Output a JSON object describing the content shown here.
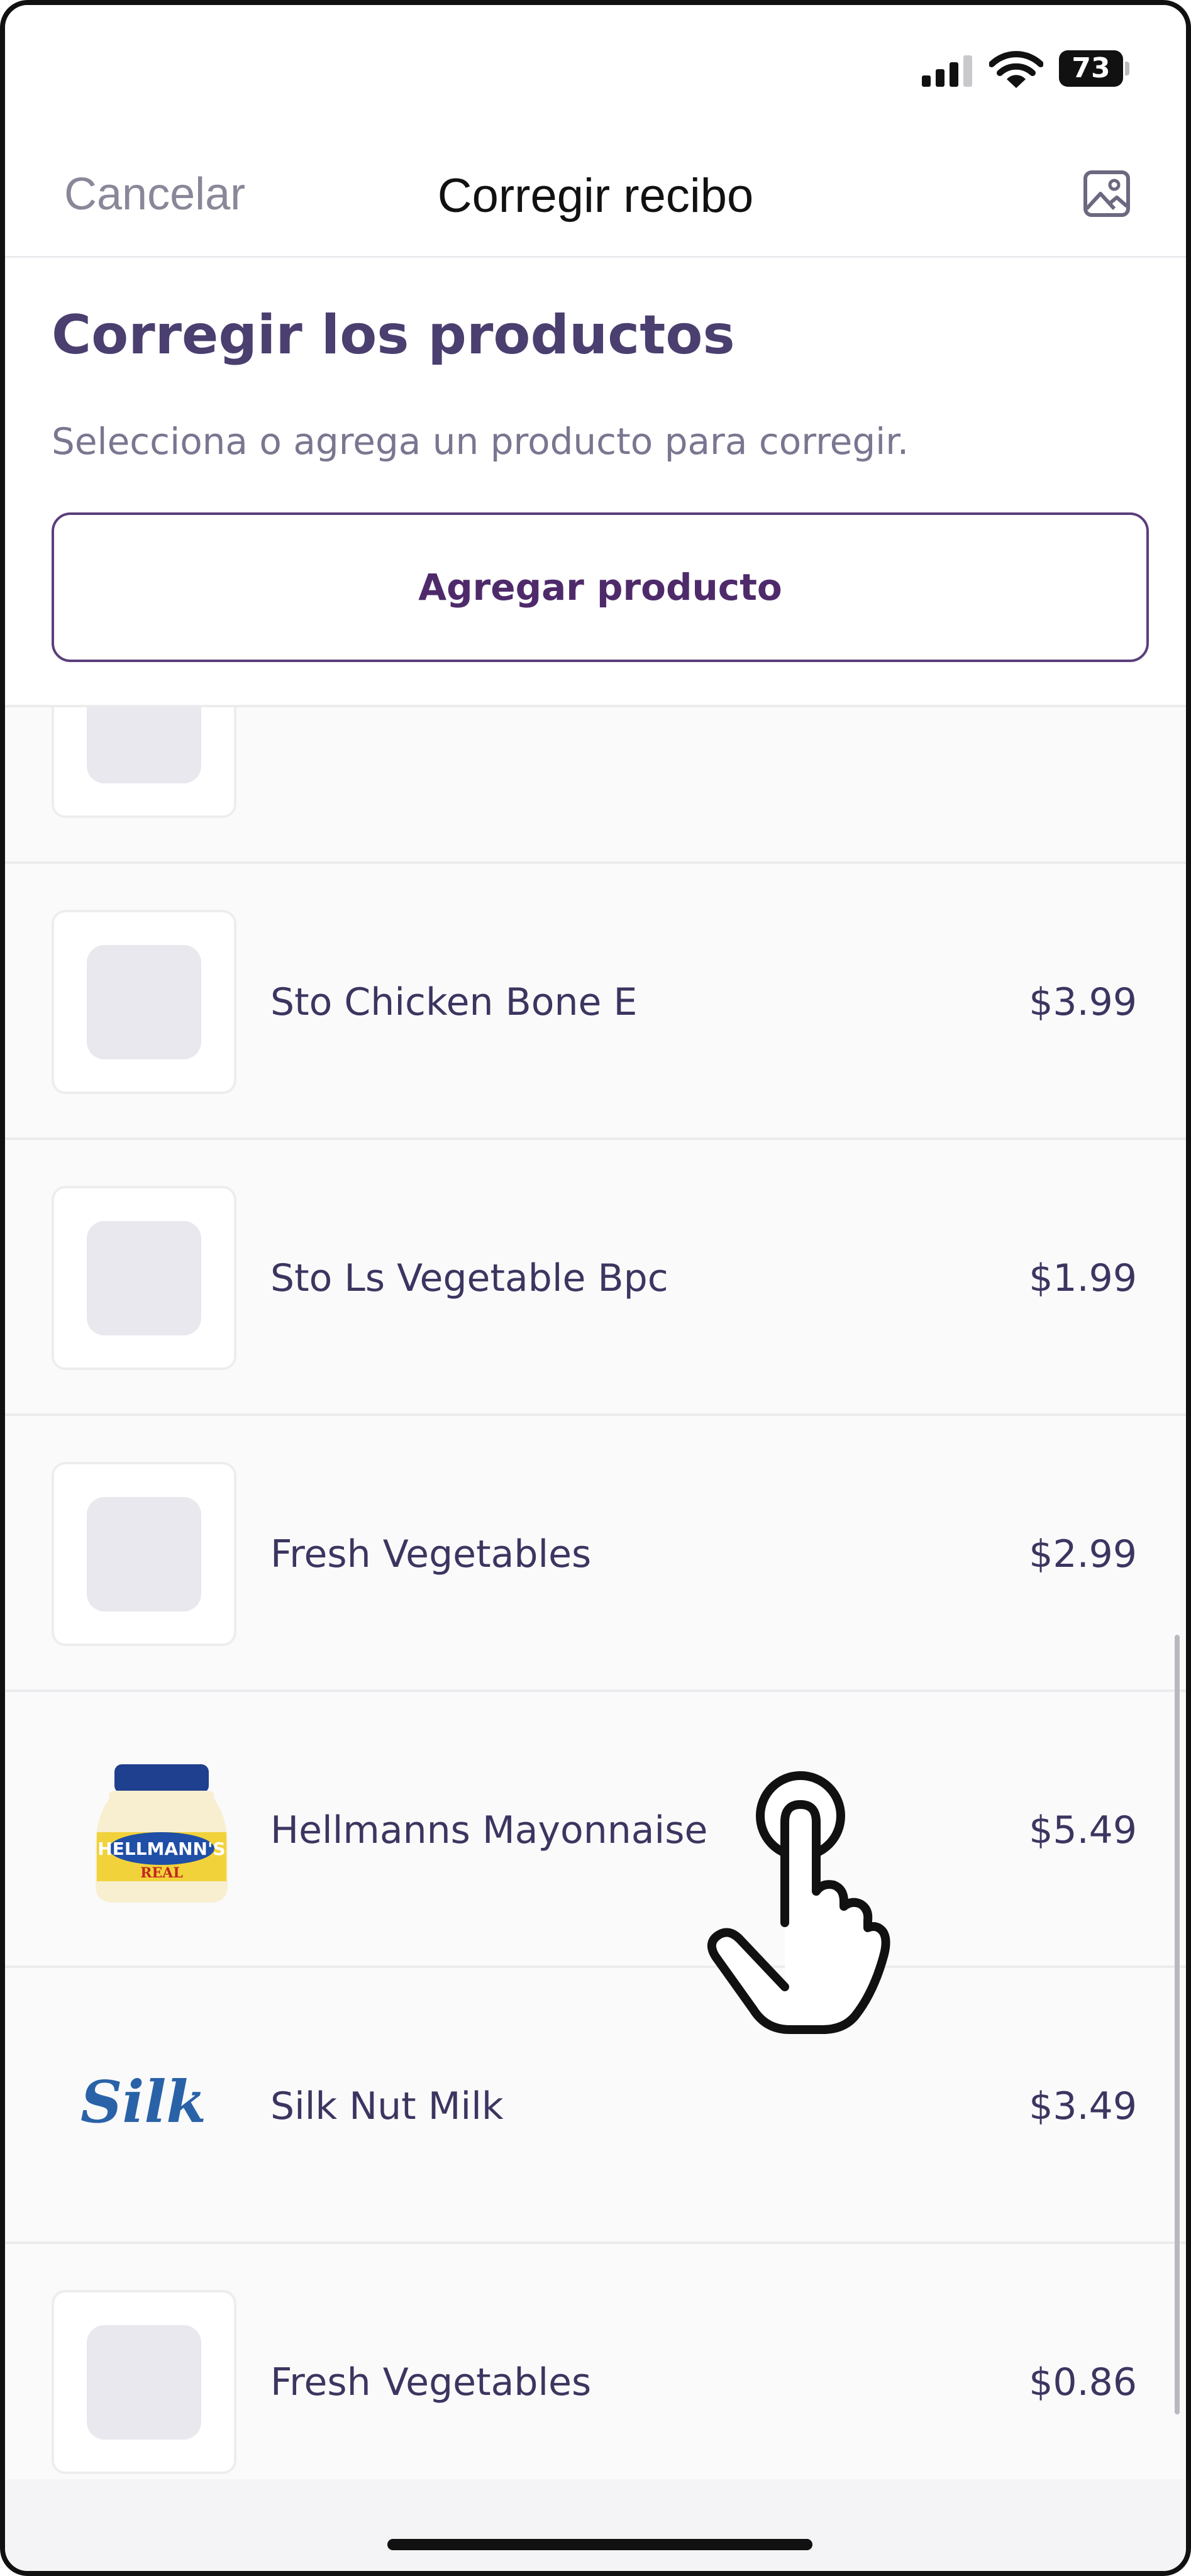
{
  "status_bar": {
    "battery": "73",
    "icons": [
      "signal-icon",
      "wifi-icon",
      "battery-icon"
    ]
  },
  "nav": {
    "cancel_label": "Cancelar",
    "title": "Corregir recibo",
    "image_icon": "image-icon"
  },
  "header": {
    "title": "Corregir los productos",
    "subtitle": "Selecciona o agrega un producto para corregir.",
    "add_button_label": "Agregar producto"
  },
  "products": [
    {
      "name": "",
      "price": "",
      "image": "placeholder"
    },
    {
      "name": "Sto Chicken Bone E",
      "price": "$3.99",
      "image": "placeholder"
    },
    {
      "name": "Sto Ls Vegetable Bpc",
      "price": "$1.99",
      "image": "placeholder"
    },
    {
      "name": "Fresh Vegetables",
      "price": "$2.99",
      "image": "placeholder"
    },
    {
      "name": "Hellmanns Mayonnaise",
      "price": "$5.49",
      "image": "mayonnaise-jar",
      "brand_label": "HELLMANN'S",
      "sub_label": "REAL"
    },
    {
      "name": "Silk Nut Milk",
      "price": "$3.49",
      "image": "silk-logo",
      "brand_label": "Silk"
    },
    {
      "name": "Fresh Vegetables",
      "price": "$0.86",
      "image": "placeholder"
    }
  ],
  "overlay": {
    "icon": "tap-hand-icon"
  },
  "colors": {
    "accent": "#4e2a6b",
    "text": "#3d3560",
    "muted": "#7a7690",
    "placeholder": "#e9e8ee",
    "divider": "#ececef"
  }
}
